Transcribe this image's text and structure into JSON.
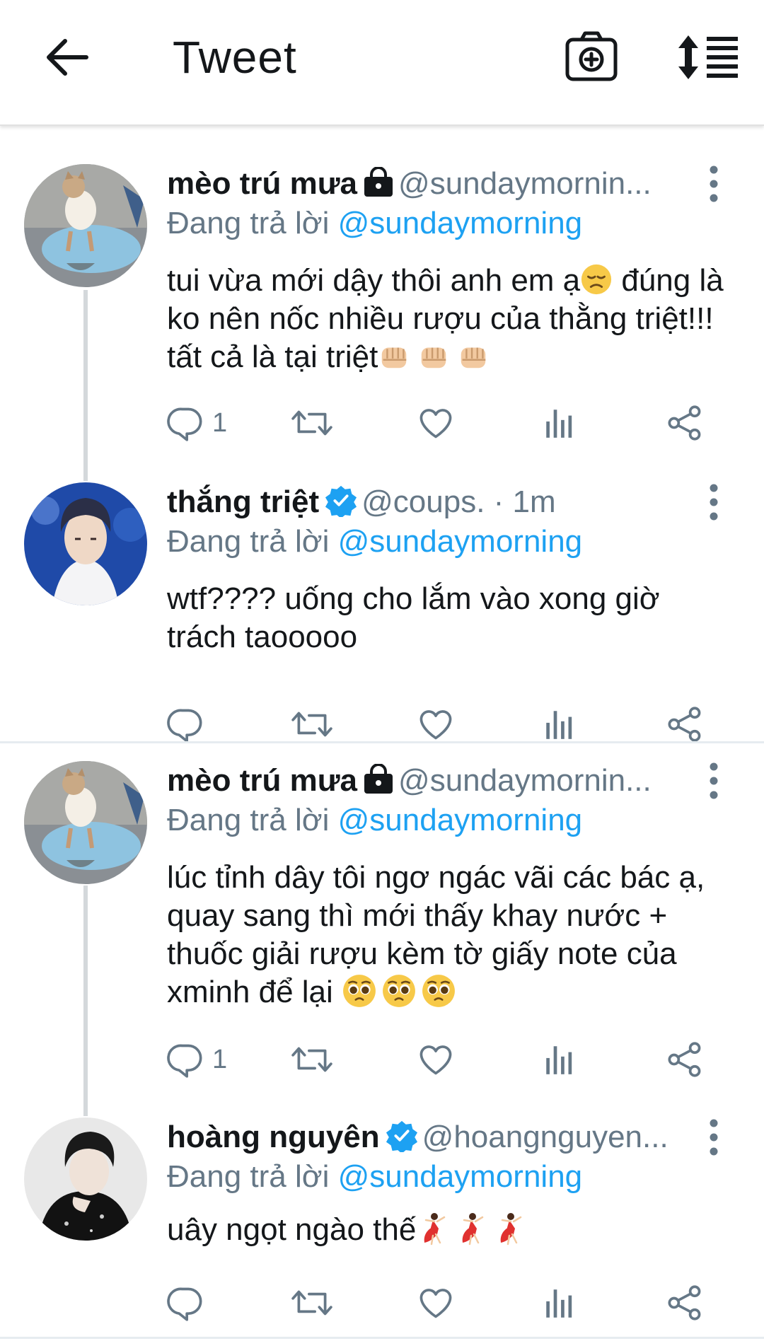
{
  "header": {
    "title": "Tweet",
    "icons": {
      "back": "arrow-left-icon",
      "camera": "camera-add-icon",
      "sort": "sort-order-icon"
    }
  },
  "colors": {
    "accent": "#1da1f2",
    "text": "#14171a",
    "muted": "#657786",
    "divider": "#e6ecf0"
  },
  "tweets": [
    {
      "name": "mèo trú mưa",
      "badge": "lock-icon",
      "handle": "@sundaymornin...",
      "meta": "",
      "reply_prefix": "Đang trả lời",
      "reply_to": "@sundaymorning",
      "text_lines": [
        "tui vừa mới dậy thôi anh em ạ",
        " đúng là ko nên nốc nhiều rượu của thằng triệt!!! tất cả là tại triệt"
      ],
      "emoji": [
        "disappointed-face",
        "fist-bump",
        "fist-bump",
        "fist-bump"
      ],
      "reply_count": "1"
    },
    {
      "name": "thắng triệt",
      "badge": "verified-icon",
      "handle": "@coups.",
      "meta": "· 1m",
      "reply_prefix": "Đang trả lời",
      "reply_to": "@sundaymorning",
      "text": "wtf???? uống cho lắm vào xong giờ trách taooooo",
      "reply_count": ""
    },
    {
      "name": "mèo trú mưa",
      "badge": "lock-icon",
      "handle": "@sundaymornin...",
      "meta": "",
      "reply_prefix": "Đang trả lời",
      "reply_to": "@sundaymorning",
      "text": "lúc tỉnh dây tôi ngơ ngác vãi các bác ạ, quay sang thì mới thấy khay nước + thuốc giải rượu kèm tờ giấy note của xminh để lại",
      "emoji": [
        "pleading-face",
        "pleading-face",
        "pleading-face"
      ],
      "reply_count": "1"
    },
    {
      "name": "hoàng nguyên",
      "badge": "verified-icon",
      "handle": "@hoangnguyen...",
      "meta": "",
      "reply_prefix": "Đang trả lời",
      "reply_to": "@sundaymorning",
      "text": "uây ngọt ngào thế",
      "emoji": [
        "dancer",
        "dancer",
        "dancer"
      ],
      "reply_count": ""
    }
  ]
}
